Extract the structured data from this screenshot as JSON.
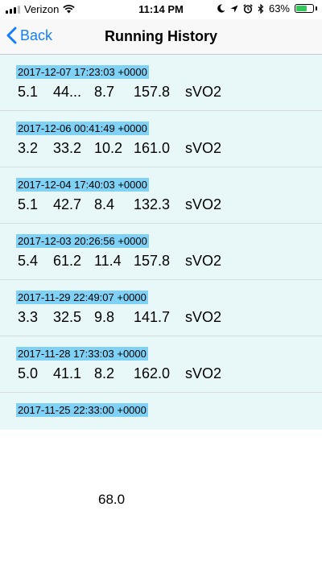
{
  "status_bar": {
    "carrier": "Verizon",
    "time": "11:14 PM",
    "battery": "63%",
    "battery_level": 0.63,
    "icons": [
      "signal-icon",
      "wifi-icon",
      "moon-icon",
      "location-icon",
      "alarm-icon",
      "bluetooth-icon",
      "battery-icon"
    ]
  },
  "nav": {
    "back_label": "Back",
    "title": "Running History"
  },
  "runs": [
    {
      "date": "2017-12-07 17:23:03 +0000",
      "v1": "5.1",
      "v2": "44...",
      "v3": "8.7",
      "v4": "157.8",
      "v5": "sVO2"
    },
    {
      "date": "2017-12-06 00:41:49 +0000",
      "v1": "3.2",
      "v2": "33.2",
      "v3": "10.2",
      "v4": "161.0",
      "v5": "sVO2"
    },
    {
      "date": "2017-12-04 17:40:03 +0000",
      "v1": "5.1",
      "v2": "42.7",
      "v3": "8.4",
      "v4": "132.3",
      "v5": "sVO2"
    },
    {
      "date": "2017-12-03 20:26:56 +0000",
      "v1": "5.4",
      "v2": "61.2",
      "v3": "11.4",
      "v4": "157.8",
      "v5": "sVO2"
    },
    {
      "date": "2017-11-29 22:49:07 +0000",
      "v1": "3.3",
      "v2": "32.5",
      "v3": "9.8",
      "v4": "141.7",
      "v5": "sVO2"
    },
    {
      "date": "2017-11-28 17:33:03 +0000",
      "v1": "5.0",
      "v2": "41.1",
      "v3": "8.2",
      "v4": "162.0",
      "v5": "sVO2"
    },
    {
      "date": "2017-11-25 22:33:00 +0000",
      "v1": "",
      "v2": "",
      "v3": "",
      "v4": "",
      "v5": ""
    }
  ],
  "bottom_value": "68.0",
  "colors": {
    "accent": "#157efb",
    "list_background": "#e8f7f7",
    "date_highlight": "#7fd2f6",
    "battery": "#34c759"
  }
}
